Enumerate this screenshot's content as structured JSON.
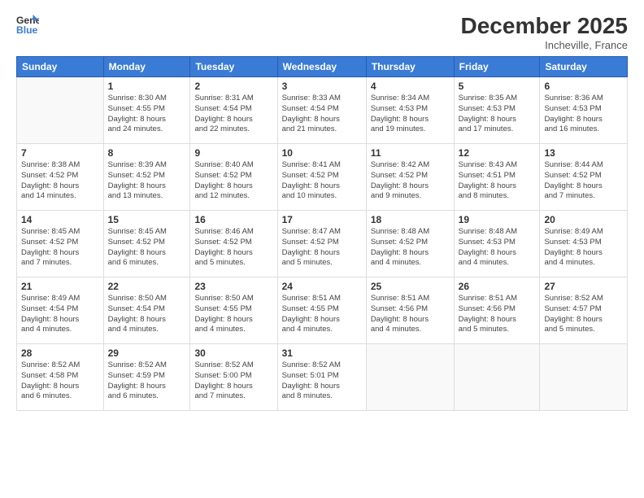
{
  "logo": {
    "line1": "General",
    "line2": "Blue"
  },
  "header": {
    "title": "December 2025",
    "subtitle": "Incheville, France"
  },
  "weekdays": [
    "Sunday",
    "Monday",
    "Tuesday",
    "Wednesday",
    "Thursday",
    "Friday",
    "Saturday"
  ],
  "weeks": [
    [
      {
        "day": "",
        "info": ""
      },
      {
        "day": "1",
        "info": "Sunrise: 8:30 AM\nSunset: 4:55 PM\nDaylight: 8 hours\nand 24 minutes."
      },
      {
        "day": "2",
        "info": "Sunrise: 8:31 AM\nSunset: 4:54 PM\nDaylight: 8 hours\nand 22 minutes."
      },
      {
        "day": "3",
        "info": "Sunrise: 8:33 AM\nSunset: 4:54 PM\nDaylight: 8 hours\nand 21 minutes."
      },
      {
        "day": "4",
        "info": "Sunrise: 8:34 AM\nSunset: 4:53 PM\nDaylight: 8 hours\nand 19 minutes."
      },
      {
        "day": "5",
        "info": "Sunrise: 8:35 AM\nSunset: 4:53 PM\nDaylight: 8 hours\nand 17 minutes."
      },
      {
        "day": "6",
        "info": "Sunrise: 8:36 AM\nSunset: 4:53 PM\nDaylight: 8 hours\nand 16 minutes."
      }
    ],
    [
      {
        "day": "7",
        "info": "Sunrise: 8:38 AM\nSunset: 4:52 PM\nDaylight: 8 hours\nand 14 minutes."
      },
      {
        "day": "8",
        "info": "Sunrise: 8:39 AM\nSunset: 4:52 PM\nDaylight: 8 hours\nand 13 minutes."
      },
      {
        "day": "9",
        "info": "Sunrise: 8:40 AM\nSunset: 4:52 PM\nDaylight: 8 hours\nand 12 minutes."
      },
      {
        "day": "10",
        "info": "Sunrise: 8:41 AM\nSunset: 4:52 PM\nDaylight: 8 hours\nand 10 minutes."
      },
      {
        "day": "11",
        "info": "Sunrise: 8:42 AM\nSunset: 4:52 PM\nDaylight: 8 hours\nand 9 minutes."
      },
      {
        "day": "12",
        "info": "Sunrise: 8:43 AM\nSunset: 4:51 PM\nDaylight: 8 hours\nand 8 minutes."
      },
      {
        "day": "13",
        "info": "Sunrise: 8:44 AM\nSunset: 4:52 PM\nDaylight: 8 hours\nand 7 minutes."
      }
    ],
    [
      {
        "day": "14",
        "info": "Sunrise: 8:45 AM\nSunset: 4:52 PM\nDaylight: 8 hours\nand 7 minutes."
      },
      {
        "day": "15",
        "info": "Sunrise: 8:45 AM\nSunset: 4:52 PM\nDaylight: 8 hours\nand 6 minutes."
      },
      {
        "day": "16",
        "info": "Sunrise: 8:46 AM\nSunset: 4:52 PM\nDaylight: 8 hours\nand 5 minutes."
      },
      {
        "day": "17",
        "info": "Sunrise: 8:47 AM\nSunset: 4:52 PM\nDaylight: 8 hours\nand 5 minutes."
      },
      {
        "day": "18",
        "info": "Sunrise: 8:48 AM\nSunset: 4:52 PM\nDaylight: 8 hours\nand 4 minutes."
      },
      {
        "day": "19",
        "info": "Sunrise: 8:48 AM\nSunset: 4:53 PM\nDaylight: 8 hours\nand 4 minutes."
      },
      {
        "day": "20",
        "info": "Sunrise: 8:49 AM\nSunset: 4:53 PM\nDaylight: 8 hours\nand 4 minutes."
      }
    ],
    [
      {
        "day": "21",
        "info": "Sunrise: 8:49 AM\nSunset: 4:54 PM\nDaylight: 8 hours\nand 4 minutes."
      },
      {
        "day": "22",
        "info": "Sunrise: 8:50 AM\nSunset: 4:54 PM\nDaylight: 8 hours\nand 4 minutes."
      },
      {
        "day": "23",
        "info": "Sunrise: 8:50 AM\nSunset: 4:55 PM\nDaylight: 8 hours\nand 4 minutes."
      },
      {
        "day": "24",
        "info": "Sunrise: 8:51 AM\nSunset: 4:55 PM\nDaylight: 8 hours\nand 4 minutes."
      },
      {
        "day": "25",
        "info": "Sunrise: 8:51 AM\nSunset: 4:56 PM\nDaylight: 8 hours\nand 4 minutes."
      },
      {
        "day": "26",
        "info": "Sunrise: 8:51 AM\nSunset: 4:56 PM\nDaylight: 8 hours\nand 5 minutes."
      },
      {
        "day": "27",
        "info": "Sunrise: 8:52 AM\nSunset: 4:57 PM\nDaylight: 8 hours\nand 5 minutes."
      }
    ],
    [
      {
        "day": "28",
        "info": "Sunrise: 8:52 AM\nSunset: 4:58 PM\nDaylight: 8 hours\nand 6 minutes."
      },
      {
        "day": "29",
        "info": "Sunrise: 8:52 AM\nSunset: 4:59 PM\nDaylight: 8 hours\nand 6 minutes."
      },
      {
        "day": "30",
        "info": "Sunrise: 8:52 AM\nSunset: 5:00 PM\nDaylight: 8 hours\nand 7 minutes."
      },
      {
        "day": "31",
        "info": "Sunrise: 8:52 AM\nSunset: 5:01 PM\nDaylight: 8 hours\nand 8 minutes."
      },
      {
        "day": "",
        "info": ""
      },
      {
        "day": "",
        "info": ""
      },
      {
        "day": "",
        "info": ""
      }
    ]
  ]
}
